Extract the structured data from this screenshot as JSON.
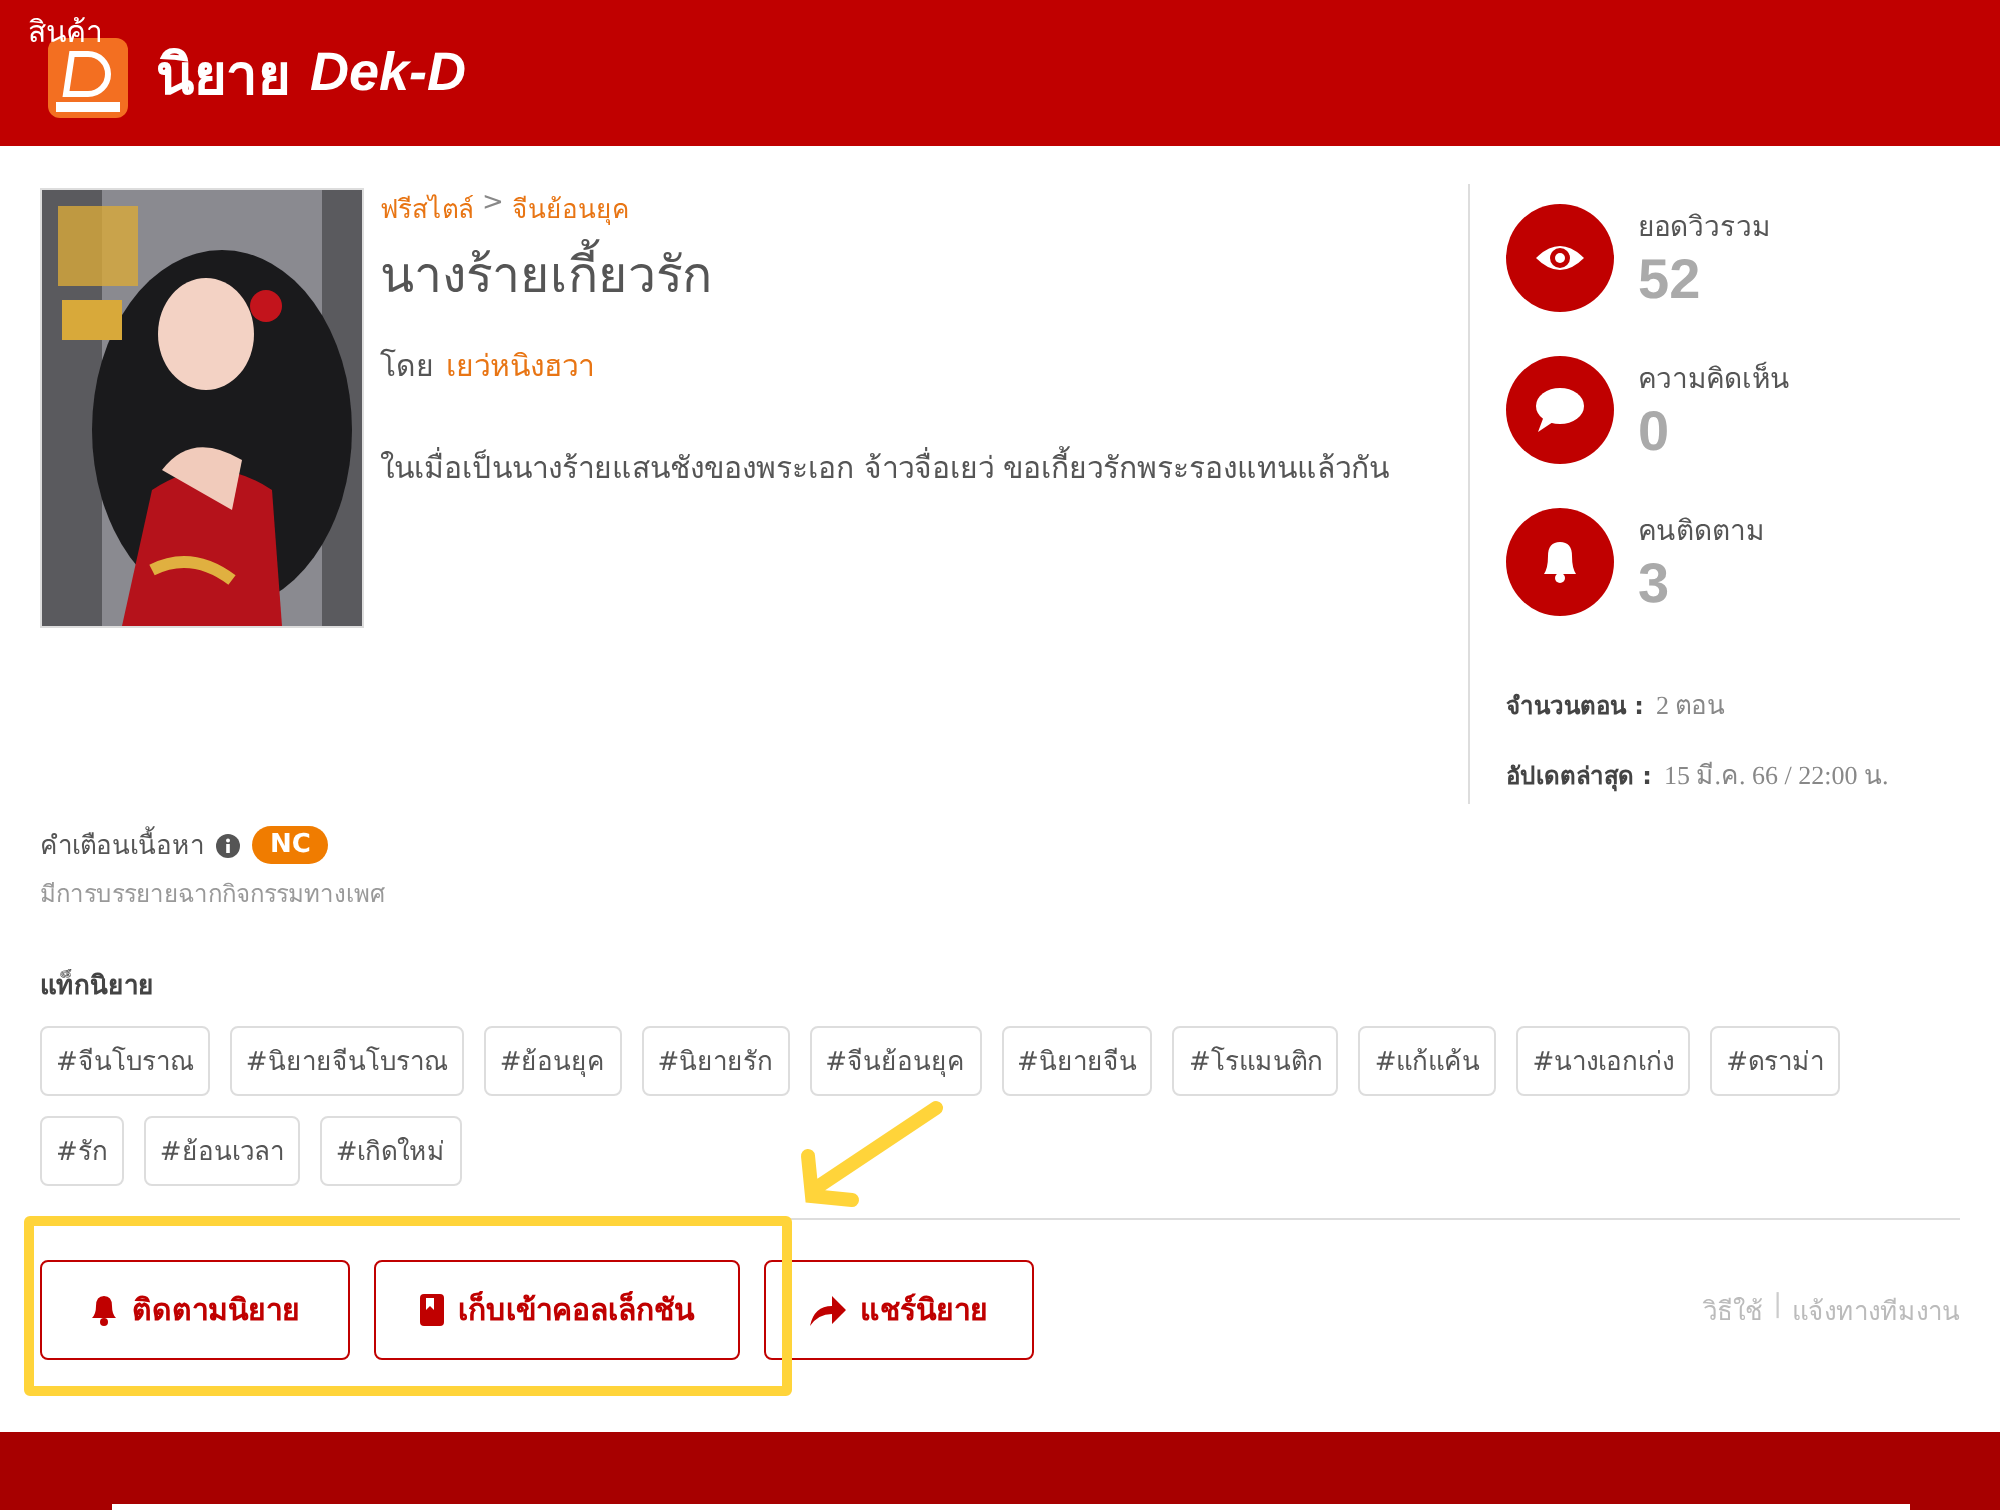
{
  "overlay_label": "สินค้า",
  "header": {
    "brand_thai": "นิยาย",
    "brand_latin": "Dek-D"
  },
  "novel": {
    "breadcrumb": [
      "ฟรีสไตล์",
      "จีนย้อนยุค"
    ],
    "breadcrumb_separator": ">",
    "title": "นางร้ายเกี้ยวรัก",
    "by_label": "โดย",
    "author": "เยว่หนิงฮวา",
    "synopsis": "ในเมื่อเป็นนางร้ายแสนชังของพระเอก จ้าวจื่อเยว่ ขอเกี้ยวรักพระรองแทนแล้วกัน"
  },
  "stats": [
    {
      "kind": "views",
      "label": "ยอดวิวรวม",
      "value": "52"
    },
    {
      "kind": "comments",
      "label": "ความคิดเห็น",
      "value": "0"
    },
    {
      "kind": "followers",
      "label": "คนติดตาม",
      "value": "3"
    }
  ],
  "info": [
    {
      "label": "จำนวนตอน :",
      "value": "2 ตอน"
    },
    {
      "label": "อัปเดตล่าสุด :",
      "value": "15 มี.ค. 66 / 22:00 น."
    }
  ],
  "warning": {
    "label": "คำเตือนเนื้อหา",
    "badge": "NC",
    "text": "มีการบรรยายฉากกิจกรรมทางเพศ"
  },
  "tags": {
    "title": "แท็กนิยาย",
    "items": [
      "#จีนโบราณ",
      "#นิยายจีนโบราณ",
      "#ย้อนยุค",
      "#นิยายรัก",
      "#จีนย้อนยุค",
      "#นิยายจีน",
      "#โรแมนติก",
      "#แก้แค้น",
      "#นางเอกเก่ง",
      "#ดราม่า",
      "#รัก",
      "#ย้อนเวลา",
      "#เกิดใหม่"
    ]
  },
  "actions": [
    {
      "kind": "follow",
      "label": "ติดตามนิยาย"
    },
    {
      "kind": "collect",
      "label": "เก็บเข้าคอลเล็กชัน"
    },
    {
      "kind": "share",
      "label": "แชร์นิยาย"
    }
  ],
  "links": [
    "วิธีใช้",
    "แจ้งทางทีมงาน"
  ],
  "link_separator": "|"
}
